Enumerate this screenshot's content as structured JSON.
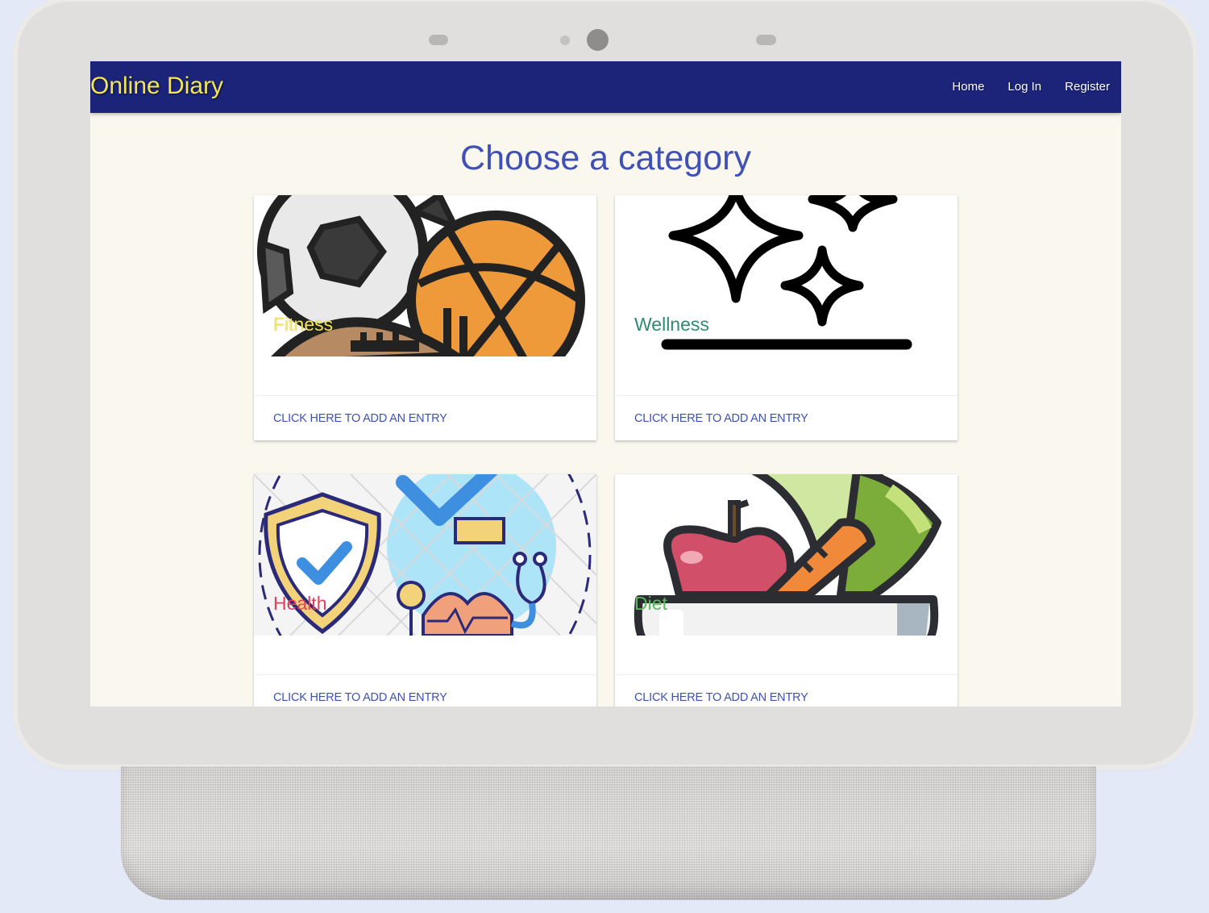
{
  "app": {
    "brand": "Online Diary"
  },
  "nav": {
    "items": [
      {
        "label": "Home"
      },
      {
        "label": "Log In"
      },
      {
        "label": "Register"
      }
    ]
  },
  "main": {
    "title": "Choose a category",
    "cards": [
      {
        "title": "Fitness",
        "title_color": "#f4e55a",
        "action": "CLICK HERE TO ADD AN ENTRY",
        "image_icon": "sports-balls-icon"
      },
      {
        "title": "Wellness",
        "title_color": "#2e8b72",
        "action": "CLICK HERE TO ADD AN ENTRY",
        "image_icon": "sparkles-icon"
      },
      {
        "title": "Health",
        "title_color": "#e0405a",
        "action": "CLICK HERE TO ADD AN ENTRY",
        "image_icon": "health-shield-icon"
      },
      {
        "title": "Diet",
        "title_color": "#5cb85c",
        "action": "CLICK HERE TO ADD AN ENTRY",
        "image_icon": "fruit-bowl-icon"
      }
    ]
  },
  "colors": {
    "navbar": "#1b2478",
    "accent": "#3f51b5",
    "page_background": "#f9f7ee",
    "brand_text": "#f4e55a"
  }
}
